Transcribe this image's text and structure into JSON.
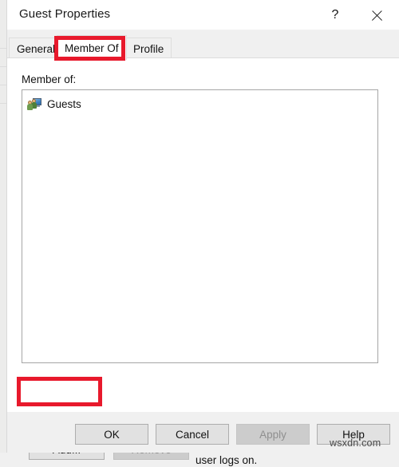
{
  "window": {
    "title": "Guest Properties",
    "caption_buttons": [
      {
        "name": "help-caption-button",
        "glyph": "?"
      },
      {
        "name": "close-caption-button",
        "glyph": "✕"
      }
    ]
  },
  "tabs": [
    {
      "label": "General",
      "selected": false
    },
    {
      "label": "Member Of",
      "selected": true
    },
    {
      "label": "Profile",
      "selected": false
    }
  ],
  "content": {
    "member_of_label": "Member of:",
    "list_items": [
      {
        "icon": "group-icon",
        "label": "Guests"
      }
    ],
    "buttons": {
      "add_label": "Add...",
      "remove_label": "Remove"
    },
    "hint_text": "Changes to a user's group membership are not effective until the next time the user logs on."
  },
  "footer": {
    "ok_label": "OK",
    "cancel_label": "Cancel",
    "apply_label": "Apply",
    "help_label": "Help"
  },
  "watermark": "wsxdn.com",
  "colors": {
    "annotation_red": "#e8192c",
    "dialog_background": "#f0f0f0",
    "content_background": "#ffffff",
    "disabled_text": "#8c8c8c"
  }
}
